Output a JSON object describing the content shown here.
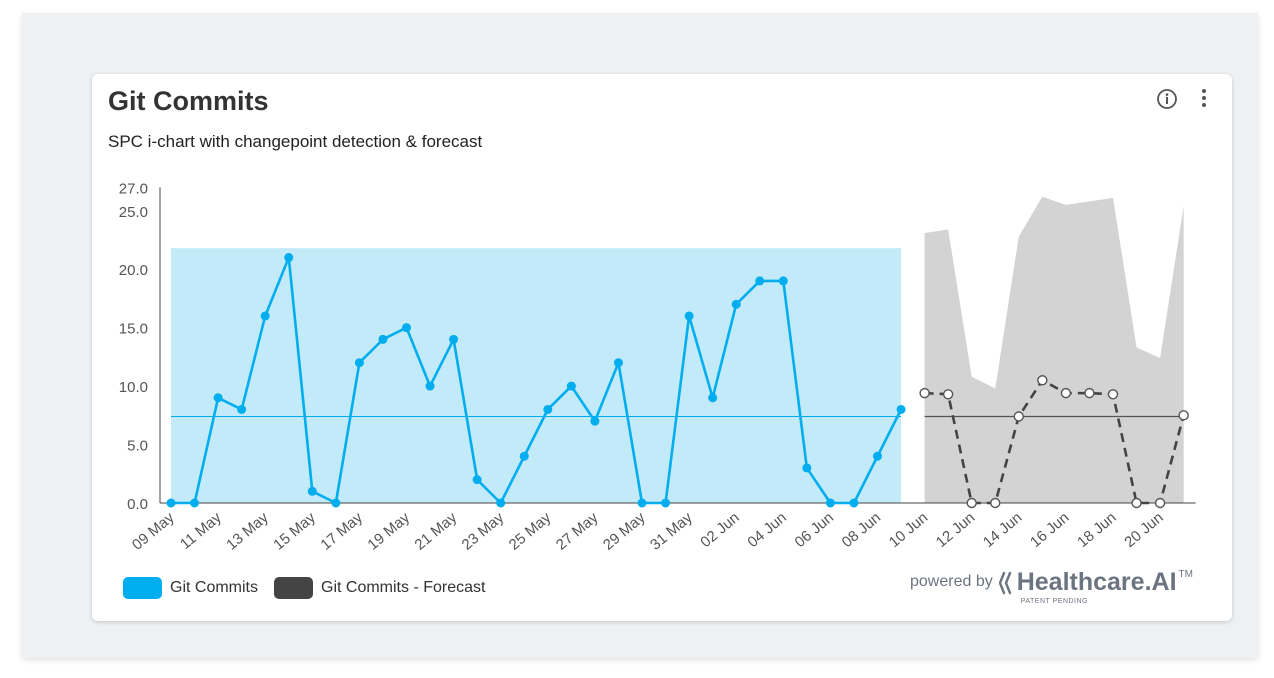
{
  "card": {
    "title": "Git Commits",
    "subtitle": "SPC i-chart with changepoint detection & forecast"
  },
  "legend": [
    {
      "label": "Git Commits",
      "color": "#00aeef"
    },
    {
      "label": "Git Commits - Forecast",
      "color": "#444444"
    }
  ],
  "branding": {
    "powered_by": "powered by",
    "brand": "Healthcare.AI",
    "tm": "TM",
    "patent": "PATENT PENDING"
  },
  "colors": {
    "actual": "#00aeef",
    "control_band": "#c3eaf9",
    "forecast_band": "#d3d3d3",
    "forecast_line": "#444444"
  },
  "chart_data": {
    "type": "line",
    "title": "Git Commits",
    "subtitle": "SPC i-chart with changepoint detection & forecast",
    "ylim": [
      0,
      27
    ],
    "y_ticks": [
      "0.0",
      "5.0",
      "10.0",
      "15.0",
      "20.0",
      "25.0",
      "27.0"
    ],
    "x_tick_labels": [
      "09 May",
      "11 May",
      "13 May",
      "15 May",
      "17 May",
      "19 May",
      "21 May",
      "23 May",
      "25 May",
      "27 May",
      "29 May",
      "31 May",
      "02 Jun",
      "04 Jun",
      "06 Jun",
      "08 Jun",
      "10 Jun",
      "12 Jun",
      "14 Jun",
      "16 Jun",
      "18 Jun",
      "20 Jun"
    ],
    "grid": false,
    "legend_position": "bottom-left",
    "series": [
      {
        "name": "Git Commits",
        "x": [
          "09 May",
          "10 May",
          "11 May",
          "12 May",
          "13 May",
          "14 May",
          "15 May",
          "16 May",
          "17 May",
          "18 May",
          "19 May",
          "20 May",
          "21 May",
          "22 May",
          "23 May",
          "24 May",
          "25 May",
          "26 May",
          "27 May",
          "28 May",
          "29 May",
          "30 May",
          "31 May",
          "01 Jun",
          "02 Jun",
          "03 Jun",
          "04 Jun",
          "05 Jun",
          "06 Jun",
          "07 Jun",
          "08 Jun",
          "09 Jun"
        ],
        "values": [
          0,
          0,
          9,
          8,
          16,
          21,
          1,
          0,
          12,
          14,
          15,
          10,
          14,
          2,
          0,
          4,
          8,
          10,
          7,
          12,
          0,
          0,
          16,
          9,
          17,
          19,
          19,
          3,
          0,
          0,
          4,
          8
        ],
        "center_line": 7.4,
        "control_band": [
          0,
          21.8
        ]
      },
      {
        "name": "Git Commits - Forecast",
        "x": [
          "10 Jun",
          "11 Jun",
          "12 Jun",
          "13 Jun",
          "14 Jun",
          "15 Jun",
          "16 Jun",
          "17 Jun",
          "18 Jun",
          "19 Jun",
          "20 Jun",
          "21 Jun"
        ],
        "values": [
          9.4,
          9.3,
          0,
          0,
          7.4,
          10.5,
          9.4,
          9.4,
          9.3,
          0,
          0,
          7.5
        ],
        "upper": [
          23.1,
          23.4,
          10.8,
          9.8,
          22.8,
          26.2,
          25.5,
          25.8,
          26.1,
          13.3,
          12.4,
          25.4
        ],
        "lower": [
          0,
          0,
          0,
          0,
          0,
          0,
          0,
          0,
          0,
          0,
          0,
          0
        ],
        "center_line": 7.4
      }
    ]
  }
}
